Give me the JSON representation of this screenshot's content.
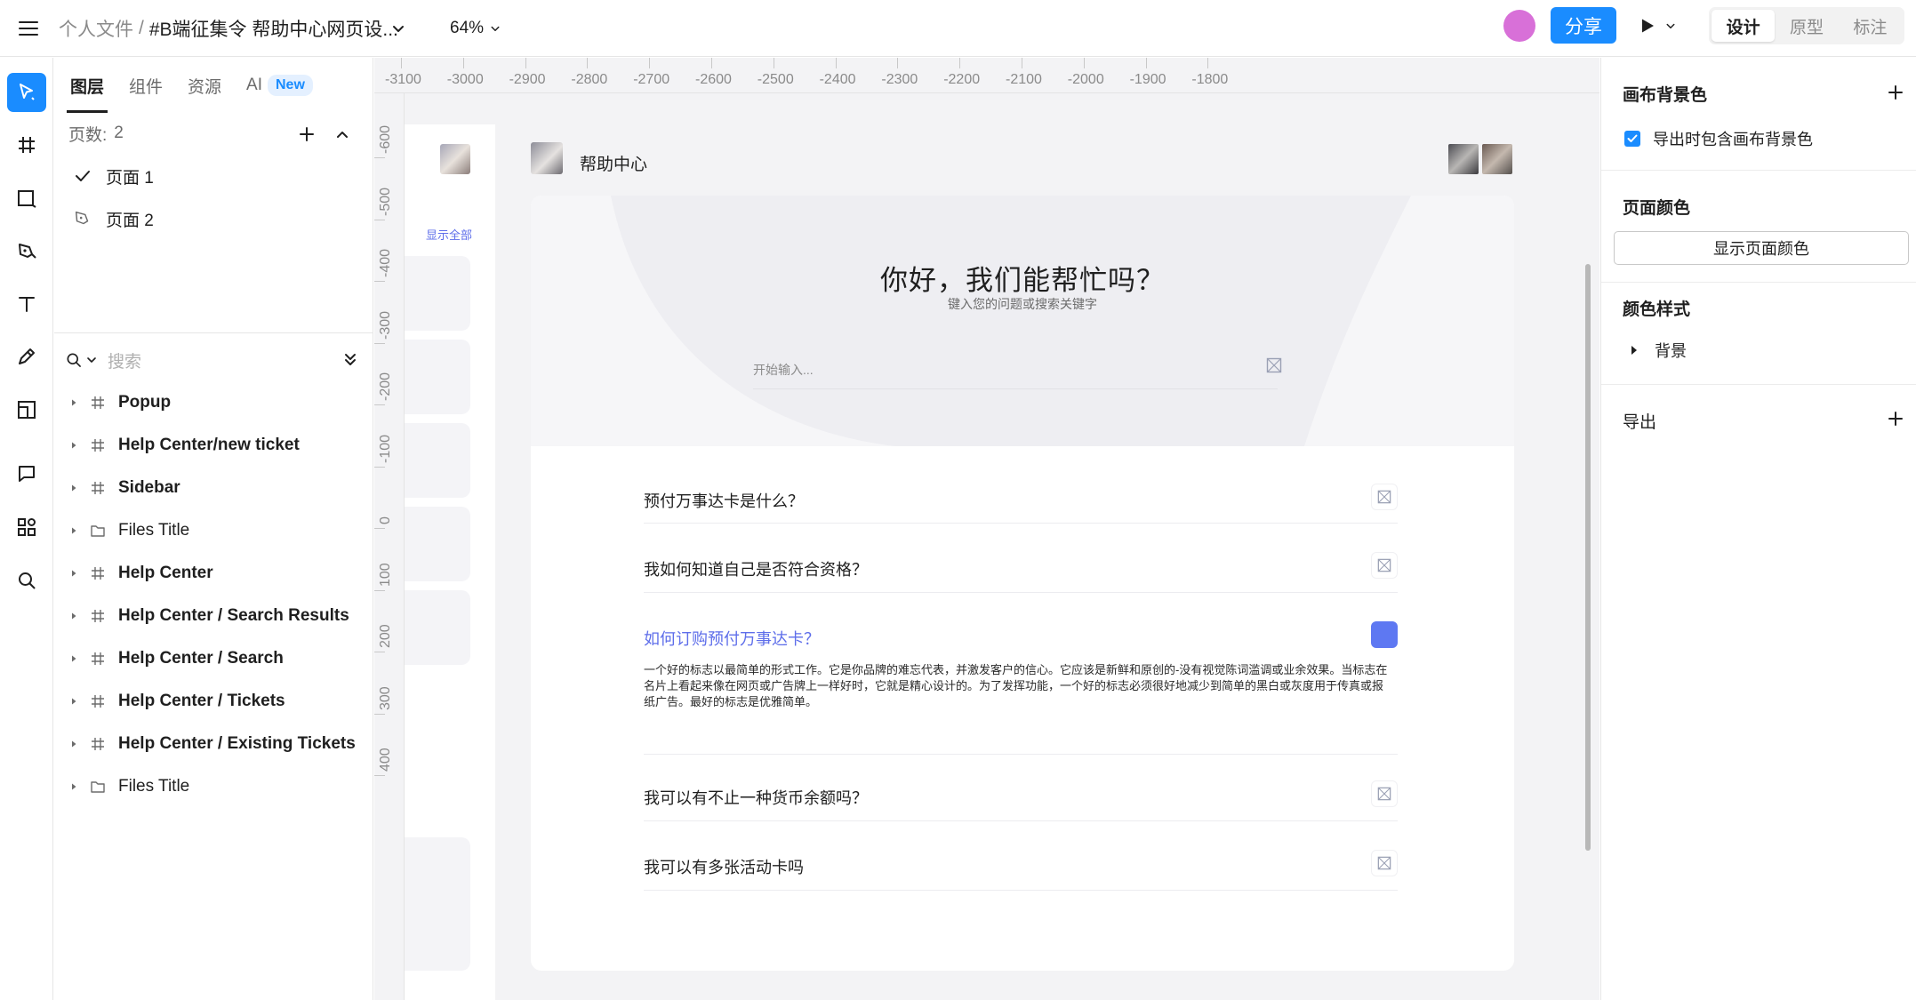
{
  "topbar": {
    "breadcrumb_root": "个人文件",
    "breadcrumb_sep": "/",
    "file_name": "#B端征集令 帮助中心网页设...",
    "zoom": "64%",
    "share_label": "分享",
    "colors": {
      "accent": "#1a8cff",
      "avatar": "#d870d8"
    },
    "mode_tabs": [
      "设计",
      "原型",
      "标注"
    ],
    "active_mode": "设计"
  },
  "toolbar": {
    "tools": [
      "move-icon",
      "frame-icon",
      "rectangle-icon",
      "pen-icon",
      "text-icon",
      "pencil-icon",
      "slice-icon",
      "comment-icon",
      "plugins-icon",
      "search-icon"
    ]
  },
  "layers_panel": {
    "tabs": [
      "图层",
      "组件",
      "资源",
      "AI"
    ],
    "ai_badge": "New",
    "pages_label": "页数:",
    "pages_count": "2",
    "pages": [
      {
        "name": "页面 1",
        "current": true
      },
      {
        "name": "页面 2",
        "current": false
      }
    ],
    "search_placeholder": "搜索",
    "layers": [
      {
        "name": "Popup",
        "type": "frame"
      },
      {
        "name": "Help Center/new ticket",
        "type": "frame"
      },
      {
        "name": "Sidebar",
        "type": "frame"
      },
      {
        "name": "Files Title",
        "type": "group"
      },
      {
        "name": "Help Center",
        "type": "frame"
      },
      {
        "name": "Help Center / Search Results",
        "type": "frame"
      },
      {
        "name": "Help Center / Search",
        "type": "frame"
      },
      {
        "name": "Help Center / Tickets",
        "type": "frame"
      },
      {
        "name": "Help Center / Existing Tickets",
        "type": "frame"
      },
      {
        "name": "Files Title",
        "type": "group"
      }
    ]
  },
  "canvas": {
    "ruler_top": [
      "-3100",
      "-3000",
      "-2900",
      "-2800",
      "-2700",
      "-2600",
      "-2500",
      "-2400",
      "-2300",
      "-2200",
      "-2100",
      "-2000",
      "-1900",
      "-1800"
    ],
    "ruler_left": [
      "-600",
      "-500",
      "-400",
      "-300",
      "-200",
      "-100",
      "0",
      "100",
      "200",
      "300",
      "400"
    ],
    "sidebar": {
      "show_all": "显示全部"
    },
    "help_center": {
      "title": "帮助中心",
      "heading": "你好，我们能帮忙吗？",
      "subheading": "键入您的问题或搜索关键字",
      "search_placeholder": "开始输入...",
      "accent": "#5e6eea",
      "faqs": [
        {
          "q": "预付万事达卡是什么？",
          "open": false
        },
        {
          "q": "我如何知道自己是否符合资格？",
          "open": false
        },
        {
          "q": "如何订购预付万事达卡？",
          "open": true,
          "a": "一个好的标志以最简单的形式工作。它是你品牌的难忘代表，并激发客户的信心。它应该是新鲜和原创的-没有视觉陈词滥调或业余效果。当标志在名片上看起来像在网页或广告牌上一样好时，它就是精心设计的。为了发挥功能，一个好的标志必须很好地减少到简单的黑白或灰度用于传真或报纸广告。最好的标志是优雅简单。"
        },
        {
          "q": "我可以有不止一种货币余额吗？",
          "open": false
        },
        {
          "q": "我可以有多张活动卡吗",
          "open": false
        }
      ]
    }
  },
  "right_panel": {
    "canvas_bg_title": "画布背景色",
    "include_bg_label": "导出时包含画布背景色",
    "page_color_title": "页面颜色",
    "show_page_color": "显示页面颜色",
    "color_style_title": "颜色样式",
    "style_bg": "背景",
    "export_title": "导出"
  }
}
